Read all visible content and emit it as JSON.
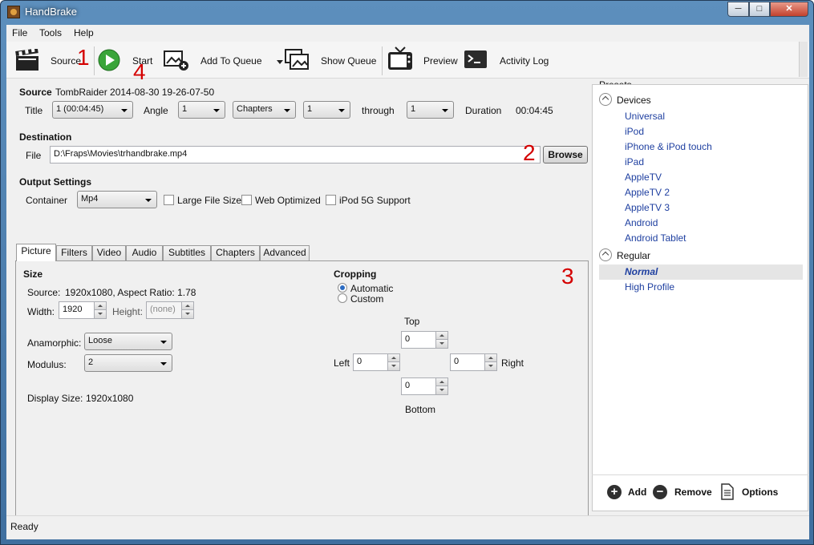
{
  "window": {
    "title": "HandBrake",
    "min_glyph": "─",
    "max_glyph": "□",
    "close_glyph": "✕"
  },
  "menu": {
    "items": [
      "File",
      "Tools",
      "Help"
    ]
  },
  "toolbar": {
    "source_label": "Source",
    "start_label": "Start",
    "add_to_queue_label": "Add To Queue",
    "show_queue_label": "Show Queue",
    "preview_label": "Preview",
    "activity_log_label": "Activity Log"
  },
  "annotations": {
    "n1": "1",
    "n2": "2",
    "n3": "3",
    "n4": "4"
  },
  "source": {
    "heading": "Source",
    "name": "TombRaider 2014-08-30 19-26-07-50",
    "title_label": "Title",
    "title_value": "1 (00:04:45)",
    "angle_label": "Angle",
    "angle_value": "1",
    "range_mode": "Chapters",
    "range_start": "1",
    "through_label": "through",
    "range_end": "1",
    "duration_label": "Duration",
    "duration_value": "00:04:45"
  },
  "destination": {
    "heading": "Destination",
    "file_label": "File",
    "file_value": "D:\\Fraps\\Movies\\trhandbrake.mp4",
    "browse_label": "Browse"
  },
  "output": {
    "heading": "Output Settings",
    "container_label": "Container",
    "container_value": "Mp4",
    "large_file_label": "Large File Size",
    "web_optimized_label": "Web Optimized",
    "ipod_label": "iPod 5G Support"
  },
  "tabs": [
    "Picture",
    "Filters",
    "Video",
    "Audio",
    "Subtitles",
    "Chapters",
    "Advanced"
  ],
  "picture": {
    "size_heading": "Size",
    "source_label": "Source:",
    "source_value": "1920x1080, Aspect Ratio: 1.78",
    "width_label": "Width:",
    "width_value": "1920",
    "height_label": "Height:",
    "height_value": "(none)",
    "anamorphic_label": "Anamorphic:",
    "anamorphic_value": "Loose",
    "modulus_label": "Modulus:",
    "modulus_value": "2",
    "display_size_label": "Display Size:",
    "display_size_value": "1920x1080",
    "cropping_heading": "Cropping",
    "automatic_label": "Automatic",
    "custom_label": "Custom",
    "top_label": "Top",
    "top_value": "0",
    "left_label": "Left",
    "left_value": "0",
    "right_label": "Right",
    "right_value": "0",
    "bottom_label": "Bottom",
    "bottom_value": "0"
  },
  "presets": {
    "heading": "Presets",
    "groups": [
      {
        "name": "Devices",
        "items": [
          "Universal",
          "iPod",
          "iPhone & iPod touch",
          "iPad",
          "AppleTV",
          "AppleTV 2",
          "AppleTV 3",
          "Android",
          "Android Tablet"
        ]
      },
      {
        "name": "Regular",
        "items": [
          "Normal",
          "High Profile"
        ]
      }
    ],
    "add_label": "Add",
    "remove_label": "Remove",
    "options_label": "Options",
    "add_glyph": "+",
    "remove_glyph": "−"
  },
  "status": {
    "text": "Ready"
  }
}
